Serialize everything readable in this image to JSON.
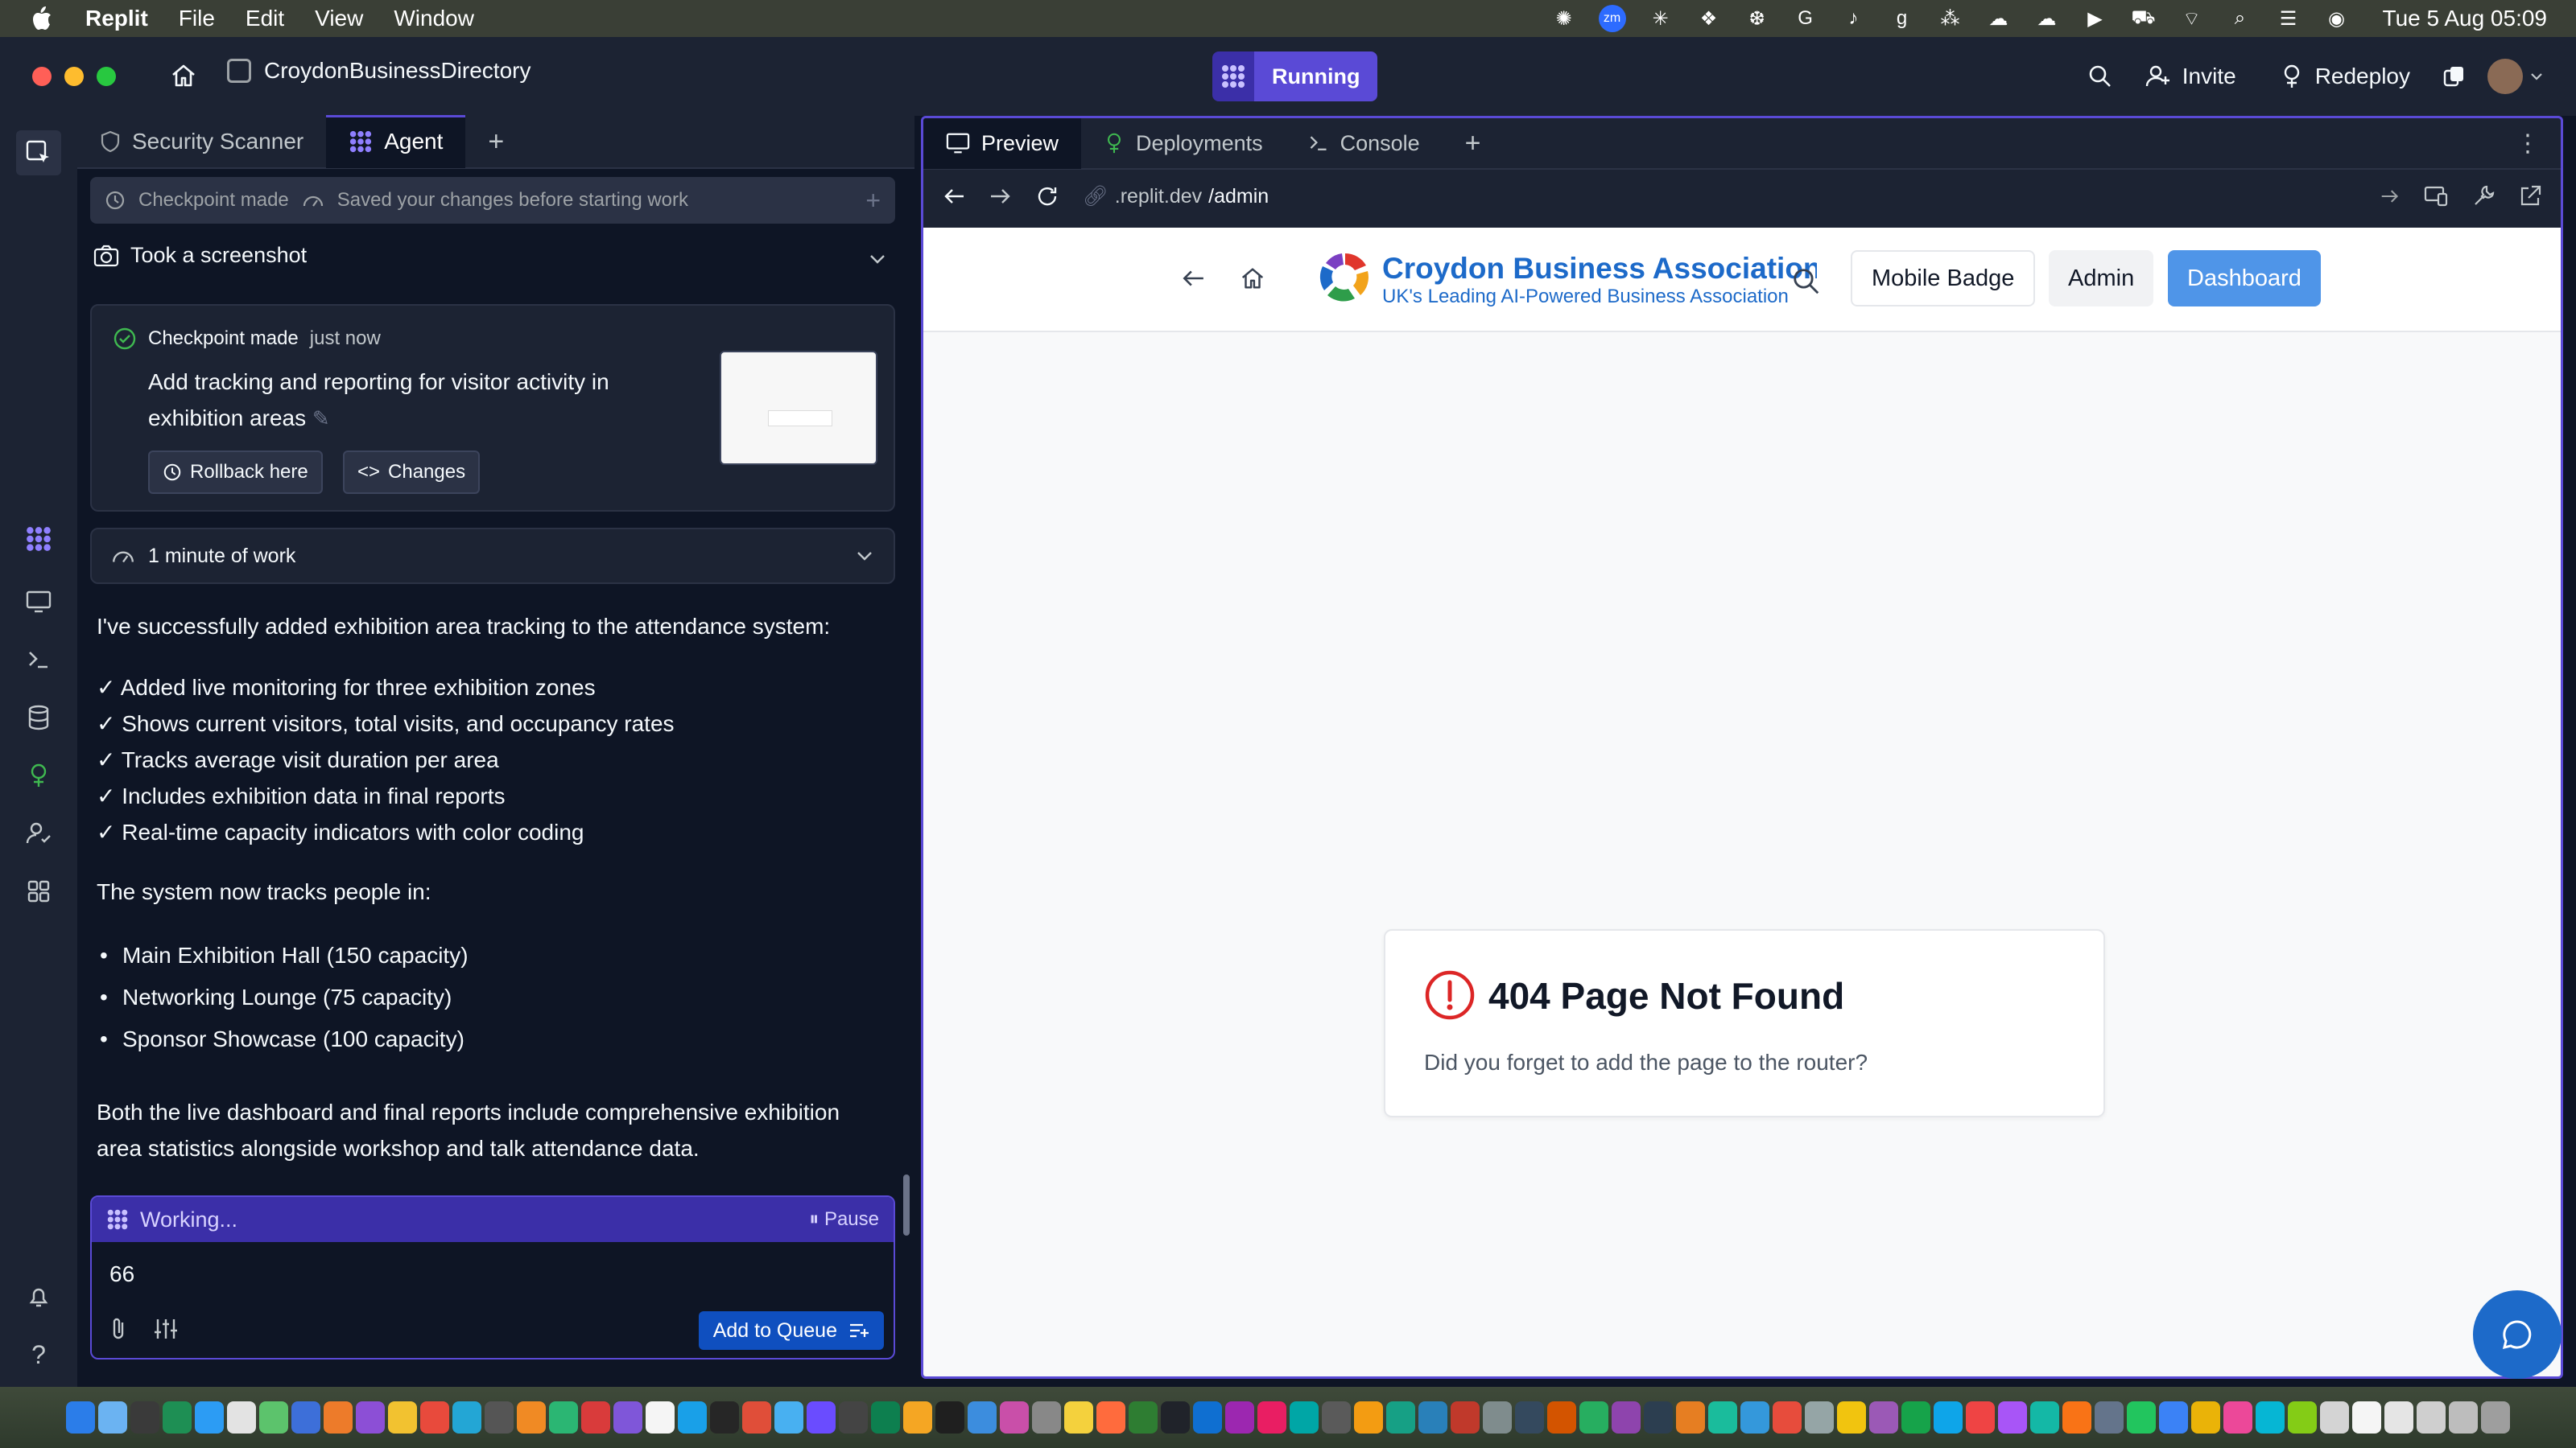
{
  "menubar": {
    "app_name": "Replit",
    "menus": [
      "File",
      "Edit",
      "View",
      "Window"
    ],
    "clock": "Tue 5 Aug  05:09"
  },
  "appbar": {
    "project_name": "CroydonBusinessDirectory",
    "status": "Running",
    "invite": "Invite",
    "redeploy": "Redeploy"
  },
  "left_tabs": [
    {
      "label": "Security Scanner"
    },
    {
      "label": "Agent"
    }
  ],
  "chat": {
    "checkpoint_bar": {
      "made": "Checkpoint made",
      "saved": "Saved your changes before starting work"
    },
    "screenshot": "Took a screenshot",
    "checkpoint_card": {
      "status": "Checkpoint made",
      "time": "just now",
      "description": "Add tracking and reporting for visitor activity in exhibition areas",
      "rollback": "Rollback here",
      "changes": "Changes"
    },
    "work": "1 minute of work",
    "intro": "I've successfully added exhibition area tracking to the attendance system:",
    "checks": [
      "✓ Added live monitoring for three exhibition zones",
      "✓ Shows current visitors, total visits, and occupancy rates",
      "✓ Tracks average visit duration per area",
      "✓ Includes exhibition data in final reports",
      "✓ Real-time capacity indicators with color coding"
    ],
    "tracks_heading": "The system now tracks people in:",
    "areas": [
      "Main Exhibition Hall (150 capacity)",
      "Networking Lounge (75 capacity)",
      "Sponsor Showcase (100 capacity)"
    ],
    "closing": "Both the live dashboard and final reports include comprehensive exhibition area statistics alongside workshop and talk attendance data."
  },
  "composer": {
    "working": "Working...",
    "pause": "Pause",
    "value": "66",
    "add_to_queue": "Add to Queue"
  },
  "right_tabs": [
    {
      "label": "Preview"
    },
    {
      "label": "Deployments"
    },
    {
      "label": "Console"
    }
  ],
  "url": {
    "prefix": ".replit.dev",
    "path": "/admin"
  },
  "site": {
    "brand_title": "Croydon Business Association",
    "brand_subtitle": "UK's Leading AI-Powered Business Association",
    "nav": {
      "mobile_badge": "Mobile Badge",
      "admin": "Admin",
      "dashboard": "Dashboard"
    },
    "error_title": "404 Page Not Found",
    "error_message": "Did you forget to add the page to the router?"
  },
  "colors": {
    "accent": "#5a4ad6",
    "brand_blue": "#1d6ac9",
    "dashboard_btn": "#4f95e8",
    "error_red": "#dc2626"
  }
}
